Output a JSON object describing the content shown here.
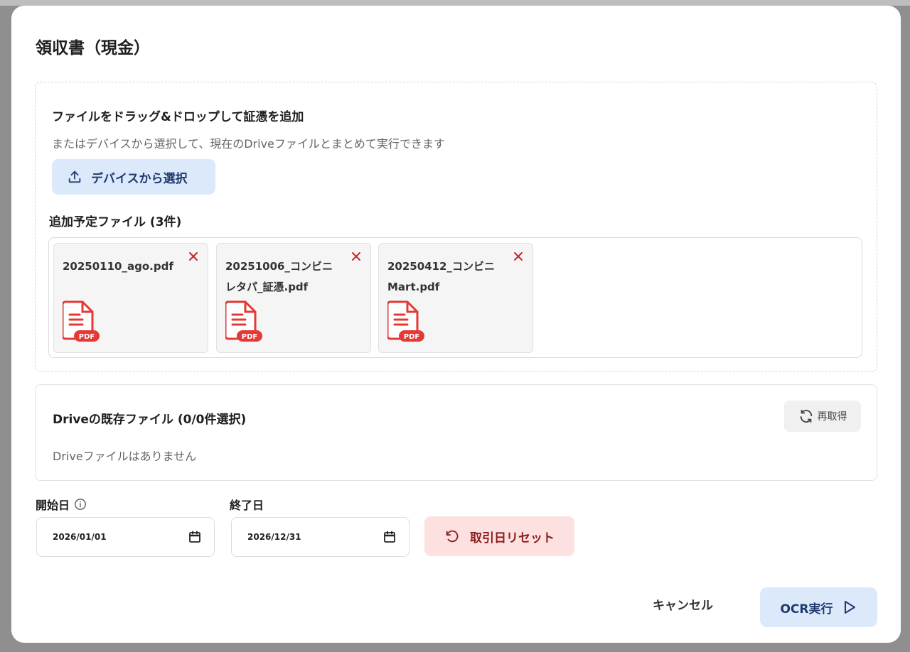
{
  "dialog": {
    "title": "領収書（現金）"
  },
  "dropzone": {
    "title": "ファイルをドラッグ&ドロップして証憑を追加",
    "subtitle": "またはデバイスから選択して、現在のDriveファイルとまとめて実行できます",
    "select_button_label": "デバイスから選択",
    "pending_label": "追加予定ファイル (3件)",
    "files": [
      {
        "name": "20250110_ago.pdf",
        "badge": "PDF"
      },
      {
        "name": "20251006_コンビニレタパ_証憑.pdf",
        "badge": "PDF"
      },
      {
        "name": "20250412_コンビニMart.pdf",
        "badge": "PDF"
      }
    ]
  },
  "drive": {
    "title": "Driveの既存ファイル (0/0件選択)",
    "empty_text": "Driveファイルはありません",
    "refetch_label": "再取得"
  },
  "dates": {
    "start_label": "開始日",
    "start_value": "2026/01/01",
    "end_label": "終了日",
    "end_value": "2026/12/31",
    "reset_label": "取引日リセット"
  },
  "footer": {
    "cancel_label": "キャンセル",
    "ocr_label": "OCR実行"
  },
  "colors": {
    "primary_button_bg": "#dbe9fb",
    "primary_text": "#1f3a6e",
    "danger_bg": "#fde0e0",
    "danger_text": "#8c1d1d",
    "pdf_red": "#e53935",
    "close_red": "#c62828"
  }
}
